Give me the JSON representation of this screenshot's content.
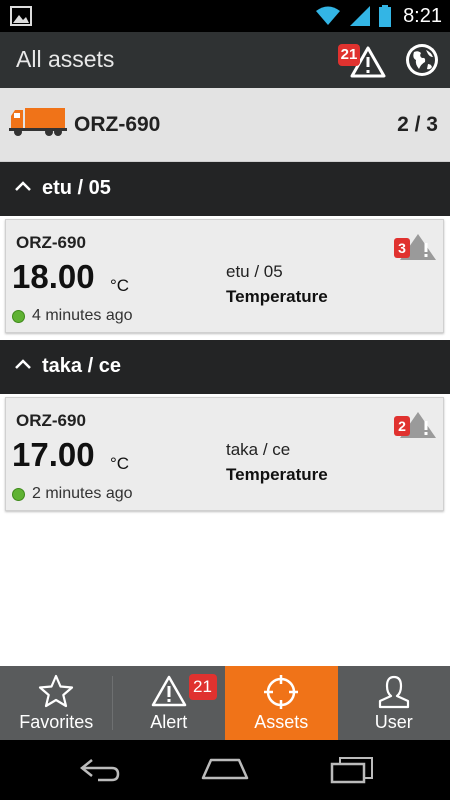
{
  "statusbar": {
    "time": "8:21"
  },
  "actionbar": {
    "title": "All assets",
    "alert_count": "21"
  },
  "asset_header": {
    "plate": "ORZ-690",
    "pager": "2 / 3"
  },
  "sections": [
    {
      "label": "etu / 05",
      "card": {
        "plate": "ORZ-690",
        "value": "18.00",
        "unit": "°C",
        "status": "4 minutes ago",
        "location": "etu / 05",
        "type": "Temperature",
        "alert_count": "3"
      }
    },
    {
      "label": "taka / ce",
      "card": {
        "plate": "ORZ-690",
        "value": "17.00",
        "unit": "°C",
        "status": "2 minutes ago",
        "location": "taka / ce",
        "type": "Temperature",
        "alert_count": "2"
      }
    }
  ],
  "tabs": [
    {
      "label": "Favorites",
      "icon": "star-icon"
    },
    {
      "label": "Alert",
      "icon": "alert-icon",
      "badge": "21"
    },
    {
      "label": "Assets",
      "icon": "crosshair-icon",
      "active": true
    },
    {
      "label": "User",
      "icon": "user-icon"
    }
  ],
  "colors": {
    "accent": "#f07318",
    "badge": "#e0322f",
    "online": "#5fb233",
    "truck": "#f07318"
  }
}
